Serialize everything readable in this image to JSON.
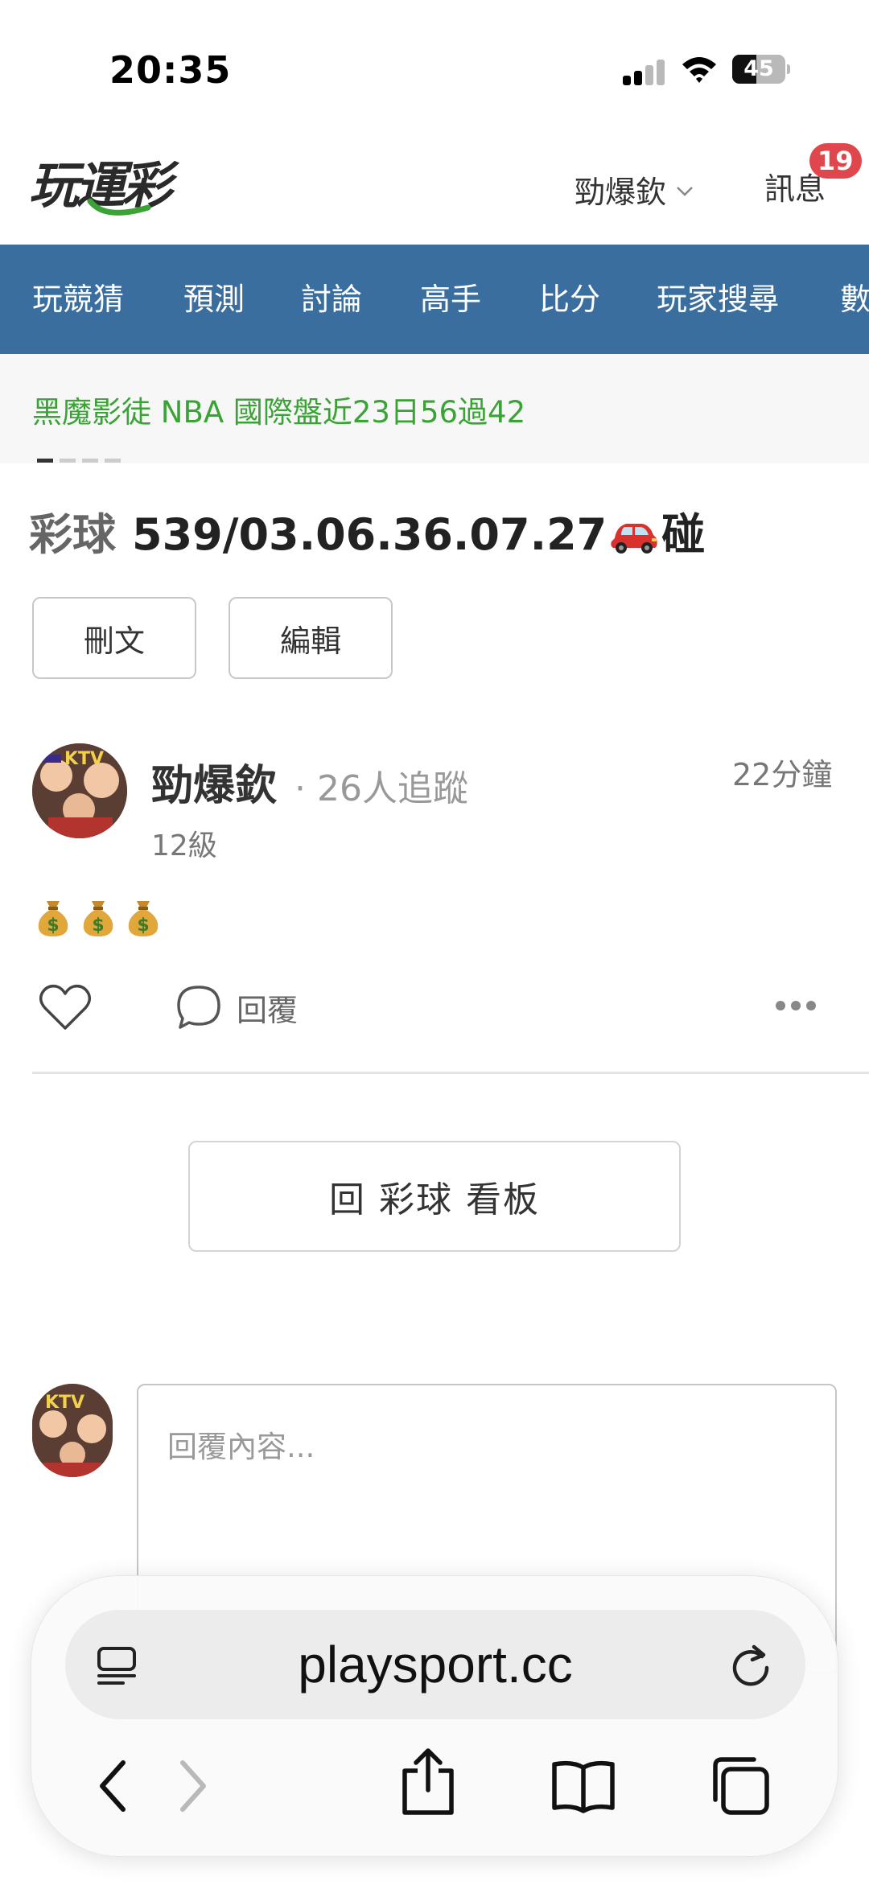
{
  "status_bar": {
    "time": "20:35",
    "battery_percent": 45,
    "battery_label": "45",
    "signal_bars_active": 2,
    "signal_bars_total": 4
  },
  "header": {
    "logo_alt": "玩運彩",
    "user_name": "勁爆欽",
    "messages_label": "訊息",
    "messages_badge": "19"
  },
  "nav": {
    "items": [
      "玩競猜",
      "預測",
      "討論",
      "高手",
      "比分",
      "玩家搜尋",
      "數"
    ]
  },
  "ticker": {
    "text": "黑魔影徒 NBA 國際盤近23日56過42",
    "dots_total": 4,
    "dots_active": 0
  },
  "post": {
    "board": "彩球",
    "title_text": "539/03.06.36.07.27",
    "title_suffix": "碰",
    "delete_label": "刪文",
    "edit_label": "編輯",
    "author_name": "勁爆欽",
    "followers": "· 26人追蹤",
    "time_ago": "22分鐘",
    "level": "12級",
    "content_icons": [
      "money-bag-icon",
      "money-bag-icon",
      "money-bag-icon"
    ],
    "reply_label": "回覆"
  },
  "back_to_board": "回 彩球 看板",
  "reply_box": {
    "placeholder": "回覆內容..."
  },
  "browser": {
    "url": "playsport.cc"
  },
  "colors": {
    "nav_bg": "#3a6e9f",
    "ticker_green": "#3aa335",
    "badge_red": "#e0474c",
    "logo_green": "#3aa335"
  }
}
